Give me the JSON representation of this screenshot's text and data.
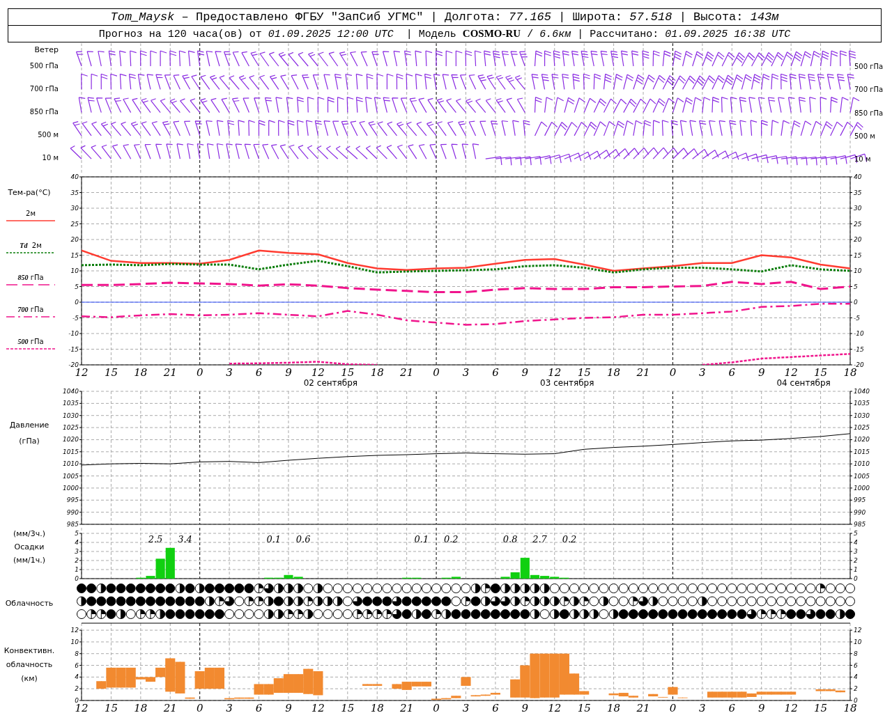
{
  "header": {
    "line_1": "*Tom_Maysk* – Предоставлено ФГБУ \"ЗапСиб УГМС\" | Долгота: *77.165* | Широта: *57.518* | Высота: *143м*",
    "line_2": "Прогноз на 120 часа(ов) от *01.09.2025 12:00 UTC*  | Модель **COSMO-RU** / *6.6км* | Рассчитано: *01.09.2025 16:38 UTC*"
  },
  "wind": {
    "title": "Ветер",
    "levels": [
      {
        "left_label": "500 гПа",
        "right_label": "500 гПа"
      },
      {
        "left_label": "700 гПа",
        "right_label": "700 гПа"
      },
      {
        "left_label": "850 гПа",
        "right_label": "850 гПа"
      },
      {
        "left_label": "500 м",
        "right_label": "500 м"
      },
      {
        "left_label": "10 м",
        "right_label": "10 м"
      }
    ]
  },
  "temperature": {
    "title": "Тем-ра(°C)",
    "right_axis_labels": [
      "40",
      "35",
      "30",
      "25",
      "20",
      "15",
      "10",
      "5",
      "0",
      "-5",
      "-10",
      "-15",
      "-20"
    ],
    "chart_data": {
      "type": "line",
      "categories": [
        "12",
        "15",
        "18",
        "21",
        "0",
        "3",
        "6",
        "9",
        "12",
        "15",
        "18",
        "21",
        "0",
        "3",
        "6",
        "9",
        "12",
        "15",
        "18",
        "21",
        "0",
        "3",
        "6",
        "9",
        "12",
        "15",
        "18"
      ],
      "ylim": [
        -20,
        40
      ],
      "yticks": [
        -20,
        -15,
        -10,
        -5,
        0,
        5,
        10,
        15,
        20,
        25,
        30,
        35,
        40
      ],
      "grid": true,
      "series": [
        {
          "name": "2м",
          "line_style": "solid",
          "color": "#ff3b30",
          "values": [
            16.5,
            13.2,
            12.5,
            12.5,
            12.3,
            13.5,
            16.5,
            15.7,
            15.3,
            12.5,
            10.8,
            10.3,
            10.8,
            11,
            12.3,
            13.5,
            13.8,
            12,
            10,
            10.8,
            11.5,
            12.5,
            12.5,
            15,
            14.3,
            12,
            10.8
          ]
        },
        {
          "name": "*Td*  2м",
          "line_style": "dotted",
          "color": "#0a7d0a",
          "values": [
            11.8,
            12,
            11.8,
            12.2,
            12,
            12,
            10.5,
            12,
            13.2,
            11.5,
            9.5,
            9.8,
            10,
            10.2,
            10.5,
            11.5,
            11.8,
            11,
            9.5,
            10.5,
            11,
            11,
            10.5,
            9.8,
            11.8,
            10.5,
            10
          ]
        },
        {
          "name": "*850* гПа",
          "line_style": "dashed",
          "color": "#f0148c",
          "values": [
            5.5,
            5.5,
            5.8,
            6.2,
            6,
            5.8,
            5.3,
            5.7,
            5.3,
            4.5,
            4,
            3.6,
            3.2,
            3.2,
            4,
            4.5,
            4.2,
            4.2,
            4.8,
            4.8,
            5,
            5.2,
            6.5,
            5.8,
            6.5,
            4.2,
            5
          ]
        },
        {
          "name": "*700* гПа",
          "line_style": "dashdot",
          "color": "#f0148c",
          "values": [
            -4.5,
            -4.8,
            -4.2,
            -3.8,
            -4.2,
            -4,
            -3.5,
            -4,
            -4.5,
            -2.8,
            -4,
            -5.8,
            -6.5,
            -7.2,
            -7,
            -6,
            -5.5,
            -5,
            -4.8,
            -4,
            -4,
            -3.5,
            -3,
            -1.5,
            -1.2,
            -0.5,
            -0.5
          ]
        },
        {
          "name": "*500* гПа",
          "line_style": "densedash",
          "color": "#f0148c",
          "values": [
            null,
            null,
            null,
            null,
            null,
            -19.6,
            -19.5,
            -19.3,
            -19,
            -19.8,
            -20,
            null,
            null,
            null,
            null,
            null,
            null,
            null,
            null,
            null,
            null,
            -20,
            -19.2,
            -18,
            -17.5,
            -17,
            -16.5
          ]
        },
        {
          "line_style": "solid",
          "color": "#3050ff",
          "values": [
            0,
            0,
            0,
            0,
            0,
            0,
            0,
            0,
            0,
            0,
            0,
            0,
            0,
            0,
            0,
            0,
            0,
            0,
            0,
            0,
            0,
            0,
            0,
            0,
            0,
            0,
            0
          ]
        }
      ],
      "annotations": [
        "02 сентября",
        "03 сентября",
        "04 сентября"
      ]
    }
  },
  "pressure": {
    "title": "Давление",
    "unit": "(гПа)",
    "right_axis_labels": [
      "1040",
      "1035",
      "1030",
      "1025",
      "1020",
      "1015",
      "1010",
      "1005",
      "1000",
      "995",
      "990",
      "985"
    ],
    "chart_data": {
      "type": "line",
      "grid": true,
      "ylim": [
        985,
        1040
      ],
      "yticks": [
        985,
        990,
        995,
        1000,
        1005,
        1010,
        1015,
        1020,
        1025,
        1030,
        1035,
        1040
      ],
      "series": [
        {
          "color": "#000000",
          "values": [
            1009.5,
            1010,
            1010.2,
            1010,
            1010.8,
            1011,
            1010.5,
            1011.5,
            1012.3,
            1013,
            1013.5,
            1013.8,
            1014.2,
            1014.5,
            1014.2,
            1014,
            1014.2,
            1016,
            1016.8,
            1017.3,
            1018,
            1018.8,
            1019.5,
            1019.8,
            1020.5,
            1021.3,
            1022.5
          ]
        }
      ]
    }
  },
  "precipitation": {
    "labels": [
      "(мм/3ч.)",
      "Осадки",
      "(мм/1ч.)"
    ],
    "right_axis_labels": [
      "5",
      "4",
      "3",
      "2",
      "1",
      "0"
    ],
    "chart_data": {
      "type": "bar",
      "grid": true,
      "ylim": [
        0,
        5
      ],
      "yticks": [
        0,
        1,
        2,
        3,
        4,
        5
      ],
      "values": [
        null,
        null,
        null,
        null,
        null,
        null,
        0.1,
        0.3,
        2.2,
        3.4,
        null,
        null,
        null,
        null,
        null,
        null,
        null,
        null,
        null,
        0.1,
        0.1,
        0.4,
        0.2,
        null,
        null,
        null,
        null,
        null,
        null,
        null,
        null,
        null,
        null,
        0.1,
        0.1,
        null,
        null,
        0.1,
        0.2,
        null,
        null,
        null,
        null,
        0.2,
        0.7,
        2.3,
        0.4,
        0.3,
        0.2,
        0.1,
        null,
        null,
        null,
        null,
        null,
        null,
        null,
        null,
        null,
        null,
        null,
        null,
        null,
        null,
        null,
        null,
        null,
        null,
        null,
        null,
        null,
        null,
        null,
        null,
        null,
        null,
        null,
        null,
        null
      ],
      "annotations": [
        "2.5",
        "3.4",
        "0.1",
        "0.6",
        "0.1",
        "0.2",
        "0.8",
        "2.7",
        "0.2"
      ]
    }
  },
  "cloudiness": {
    "title": "Облачность",
    "rows": [
      {
        "symbols": [
          {
            "kind": "overcast"
          },
          {
            "kind": "overcast"
          },
          {
            "kind": "half"
          },
          {
            "kind": "overcast"
          },
          {
            "kind": "overcast"
          },
          {
            "kind": "overcast"
          },
          {
            "kind": "overcast"
          },
          {
            "kind": "overcast"
          },
          {
            "kind": "overcast"
          },
          {
            "kind": "overcast"
          },
          {
            "kind": "half"
          },
          {
            "kind": "overcast"
          },
          {
            "kind": "half"
          },
          {
            "kind": "overcast"
          },
          {
            "kind": "overcast"
          },
          {
            "kind": "overcast"
          },
          {
            "kind": "overcast"
          },
          {
            "kind": "overcast"
          },
          {
            "kind": "quarter"
          },
          {
            "kind": "threequarter"
          },
          {
            "kind": "half"
          },
          {
            "kind": "half"
          },
          {
            "kind": "half"
          },
          {
            "kind": "clear"
          },
          {
            "kind": "half"
          },
          {
            "kind": "clear"
          },
          {
            "kind": "clear"
          },
          {
            "kind": "clear"
          },
          {
            "kind": "clear"
          },
          {
            "kind": "clear"
          },
          {
            "kind": "clear"
          },
          {
            "kind": "clear"
          },
          {
            "kind": "clear"
          },
          {
            "kind": "clear"
          },
          {
            "kind": "clear"
          },
          {
            "kind": "clear"
          },
          {
            "kind": "clear"
          },
          {
            "kind": "clear"
          },
          {
            "kind": "clear"
          },
          {
            "kind": "clear"
          },
          {
            "kind": "half"
          },
          {
            "kind": "quarter"
          },
          {
            "kind": "overcast"
          },
          {
            "kind": "half"
          },
          {
            "kind": "half"
          },
          {
            "kind": "half"
          },
          {
            "kind": "half"
          },
          {
            "kind": "half"
          },
          {
            "kind": "clear"
          },
          {
            "kind": "clear"
          },
          {
            "kind": "clear"
          },
          {
            "kind": "clear"
          },
          {
            "kind": "clear"
          },
          {
            "kind": "clear"
          },
          {
            "kind": "clear"
          },
          {
            "kind": "clear"
          },
          {
            "kind": "clear"
          },
          {
            "kind": "clear"
          },
          {
            "kind": "clear"
          },
          {
            "kind": "clear"
          },
          {
            "kind": "clear"
          },
          {
            "kind": "clear"
          },
          {
            "kind": "clear"
          },
          {
            "kind": "clear"
          },
          {
            "kind": "clear"
          },
          {
            "kind": "clear"
          },
          {
            "kind": "clear"
          },
          {
            "kind": "clear"
          },
          {
            "kind": "clear"
          },
          {
            "kind": "clear"
          },
          {
            "kind": "clear"
          },
          {
            "kind": "clear"
          },
          {
            "kind": "clear"
          },
          {
            "kind": "clear"
          },
          {
            "kind": "clear"
          },
          {
            "kind": "quarter"
          },
          {
            "kind": "clear"
          },
          {
            "kind": "clear"
          },
          {
            "kind": "clear"
          }
        ]
      },
      {
        "symbols": [
          {
            "kind": "half"
          },
          {
            "kind": "overcast"
          },
          {
            "kind": "overcast"
          },
          {
            "kind": "overcast"
          },
          {
            "kind": "overcast"
          },
          {
            "kind": "overcast"
          },
          {
            "kind": "overcast"
          },
          {
            "kind": "overcast"
          },
          {
            "kind": "overcast"
          },
          {
            "kind": "overcast"
          },
          {
            "kind": "overcast"
          },
          {
            "kind": "overcast"
          },
          {
            "kind": "overcast"
          },
          {
            "kind": "half"
          },
          {
            "kind": "quarter"
          },
          {
            "kind": "threequarter"
          },
          {
            "kind": "clear"
          },
          {
            "kind": "quarter"
          },
          {
            "kind": "quarter"
          },
          {
            "kind": "half"
          },
          {
            "kind": "overcast"
          },
          {
            "kind": "half"
          },
          {
            "kind": "half"
          },
          {
            "kind": "quarter"
          },
          {
            "kind": "half"
          },
          {
            "kind": "half"
          },
          {
            "kind": "half"
          },
          {
            "kind": "clear"
          },
          {
            "kind": "threequarter"
          },
          {
            "kind": "overcast"
          },
          {
            "kind": "overcast"
          },
          {
            "kind": "overcast"
          },
          {
            "kind": "threequarter"
          },
          {
            "kind": "overcast"
          },
          {
            "kind": "overcast"
          },
          {
            "kind": "overcast"
          },
          {
            "kind": "overcast"
          },
          {
            "kind": "overcast"
          },
          {
            "kind": "clear"
          },
          {
            "kind": "quarter"
          },
          {
            "kind": "overcast"
          },
          {
            "kind": "half"
          },
          {
            "kind": "threequarter"
          },
          {
            "kind": "threequarter"
          },
          {
            "kind": "half"
          },
          {
            "kind": "quarter"
          },
          {
            "kind": "half"
          },
          {
            "kind": "half"
          },
          {
            "kind": "half"
          },
          {
            "kind": "quarter"
          },
          {
            "kind": "half"
          },
          {
            "kind": "quarter"
          },
          {
            "kind": "clear"
          },
          {
            "kind": "half"
          },
          {
            "kind": "clear"
          },
          {
            "kind": "clear"
          },
          {
            "kind": "quarter"
          },
          {
            "kind": "threequarter"
          },
          {
            "kind": "half"
          },
          {
            "kind": "clear"
          },
          {
            "kind": "clear"
          },
          {
            "kind": "clear"
          },
          {
            "kind": "clear"
          },
          {
            "kind": "half"
          },
          {
            "kind": "clear"
          },
          {
            "kind": "clear"
          },
          {
            "kind": "clear"
          },
          {
            "kind": "clear"
          },
          {
            "kind": "clear"
          },
          {
            "kind": "clear"
          },
          {
            "kind": "clear"
          },
          {
            "kind": "clear"
          },
          {
            "kind": "clear"
          },
          {
            "kind": "clear"
          },
          {
            "kind": "clear"
          },
          {
            "kind": "clear"
          },
          {
            "kind": "clear"
          },
          {
            "kind": "clear"
          },
          {
            "kind": "clear"
          }
        ]
      },
      {
        "symbols": [
          {
            "kind": "clear"
          },
          {
            "kind": "quarter"
          },
          {
            "kind": "quarter"
          },
          {
            "kind": "overcast"
          },
          {
            "kind": "half"
          },
          {
            "kind": "clear"
          },
          {
            "kind": "quarter"
          },
          {
            "kind": "quarter"
          },
          {
            "kind": "half"
          },
          {
            "kind": "overcast"
          },
          {
            "kind": "overcast"
          },
          {
            "kind": "overcast"
          },
          {
            "kind": "overcast"
          },
          {
            "kind": "overcast"
          },
          {
            "kind": "overcast"
          },
          {
            "kind": "clear"
          },
          {
            "kind": "clear"
          },
          {
            "kind": "clear"
          },
          {
            "kind": "clear"
          },
          {
            "kind": "half"
          },
          {
            "kind": "half"
          },
          {
            "kind": "quarter"
          },
          {
            "kind": "quarter"
          },
          {
            "kind": "half"
          },
          {
            "kind": "clear"
          },
          {
            "kind": "clear"
          },
          {
            "kind": "clear"
          },
          {
            "kind": "clear"
          },
          {
            "kind": "quarter"
          },
          {
            "kind": "quarter"
          },
          {
            "kind": "quarter"
          },
          {
            "kind": "quarter"
          },
          {
            "kind": "threequarter"
          },
          {
            "kind": "overcast"
          },
          {
            "kind": "half"
          },
          {
            "kind": "overcast"
          },
          {
            "kind": "quarter"
          },
          {
            "kind": "half"
          },
          {
            "kind": "overcast"
          },
          {
            "kind": "overcast"
          },
          {
            "kind": "overcast"
          },
          {
            "kind": "overcast"
          },
          {
            "kind": "overcast"
          },
          {
            "kind": "overcast"
          },
          {
            "kind": "overcast"
          },
          {
            "kind": "overcast"
          },
          {
            "kind": "half"
          },
          {
            "kind": "clear"
          },
          {
            "kind": "half"
          },
          {
            "kind": "overcast"
          },
          {
            "kind": "half"
          },
          {
            "kind": "half"
          },
          {
            "kind": "half"
          },
          {
            "kind": "clear"
          },
          {
            "kind": "half"
          },
          {
            "kind": "overcast"
          },
          {
            "kind": "overcast"
          },
          {
            "kind": "overcast"
          },
          {
            "kind": "overcast"
          },
          {
            "kind": "overcast"
          },
          {
            "kind": "overcast"
          },
          {
            "kind": "overcast"
          },
          {
            "kind": "overcast"
          },
          {
            "kind": "overcast"
          },
          {
            "kind": "overcast"
          },
          {
            "kind": "overcast"
          },
          {
            "kind": "overcast"
          },
          {
            "kind": "overcast"
          },
          {
            "kind": "threequarter"
          },
          {
            "kind": "quarter"
          },
          {
            "kind": "quarter"
          },
          {
            "kind": "quarter"
          },
          {
            "kind": "overcast"
          },
          {
            "kind": "overcast"
          },
          {
            "kind": "threequarter"
          },
          {
            "kind": "overcast"
          },
          {
            "kind": "overcast"
          },
          {
            "kind": "half"
          },
          {
            "kind": "overcast"
          }
        ]
      }
    ]
  },
  "convective": {
    "labels": [
      "Конвективн.",
      "облачность",
      "(км)"
    ],
    "right_axis_labels": [
      "12",
      "10",
      "8",
      "6",
      "4",
      "2",
      "0"
    ],
    "chart_data": {
      "type": "candlestick",
      "grid": true,
      "ylim": [
        0,
        13.2
      ],
      "yticks": [
        0,
        2,
        4,
        6,
        8,
        10,
        12
      ],
      "categories": [
        "12",
        null,
        null,
        "15",
        null,
        null,
        "18",
        null,
        null,
        "21",
        null,
        null,
        "0",
        null,
        null,
        "3",
        null,
        null,
        "6",
        null,
        null,
        "9",
        null,
        null,
        "12",
        null,
        null,
        "15",
        null,
        null,
        "18",
        null,
        null,
        "21",
        null,
        null,
        "0",
        null,
        null,
        "3",
        null,
        null,
        "6",
        null,
        null,
        "9",
        null,
        null,
        "12",
        null,
        null,
        "15",
        null,
        null,
        "18",
        null,
        null,
        "21",
        null,
        null,
        "0",
        null,
        null,
        "3",
        null,
        null,
        "6",
        null,
        null,
        "9",
        null,
        null,
        "12",
        null,
        null,
        "15",
        null,
        null,
        "18"
      ],
      "color": "#f28a30",
      "ohlc": [
        null,
        null,
        [
          2,
          3.3,
          2,
          3.3
        ],
        [
          2.2,
          5.6,
          2.2,
          5.6
        ],
        [
          2.2,
          5.6,
          2.2,
          5.6
        ],
        [
          2.2,
          5.6,
          2.2,
          5.6
        ],
        [
          3.6,
          4,
          3.6,
          4
        ],
        [
          3.2,
          4,
          3.2,
          4
        ],
        [
          4,
          5.6,
          4,
          5.6
        ],
        [
          1.5,
          7.2,
          1.5,
          7.2
        ],
        [
          1.2,
          6.6,
          1.2,
          6.6
        ],
        [
          0.3,
          0.5,
          0.3,
          0.5
        ],
        [
          2,
          5,
          2,
          5
        ],
        [
          2,
          5.6,
          2,
          5.6
        ],
        [
          2,
          5.6,
          2,
          5.6
        ],
        [
          0.2,
          0.4,
          0.2,
          0.4
        ],
        [
          0.3,
          0.5,
          0.3,
          0.5
        ],
        [
          0.3,
          0.5,
          0.3,
          0.5
        ],
        [
          1,
          2.8,
          1,
          2.8
        ],
        [
          1,
          2.8,
          1,
          2.8
        ],
        [
          1.3,
          3.8,
          1.3,
          3.8
        ],
        [
          1.3,
          4.5,
          1.3,
          4.5
        ],
        [
          1.3,
          4.5,
          1.3,
          4.5
        ],
        [
          1.1,
          5.4,
          1.1,
          5.4
        ],
        [
          0.9,
          5,
          0.9,
          5
        ],
        null,
        null,
        null,
        null,
        [
          2.5,
          2.8,
          2.5,
          2.8
        ],
        [
          2.5,
          2.8,
          2.5,
          2.8
        ],
        null,
        [
          2,
          2.8,
          2,
          2.8
        ],
        [
          1.8,
          3.2,
          1.8,
          3.2
        ],
        [
          2.4,
          3.2,
          2.4,
          3.2
        ],
        [
          2.4,
          3.2,
          2.4,
          3.2
        ],
        [
          0.1,
          0.3,
          0.1,
          0.3
        ],
        [
          0.2,
          0.4,
          0.2,
          0.4
        ],
        [
          0.4,
          0.8,
          0.4,
          0.8
        ],
        [
          2.5,
          4,
          2.5,
          4
        ],
        [
          0.7,
          0.9,
          0.7,
          0.9
        ],
        [
          0.8,
          1,
          0.8,
          1
        ],
        [
          1,
          1.3,
          1,
          1.3
        ],
        null,
        [
          0.5,
          3.6,
          0.5,
          3.6
        ],
        [
          0.5,
          6,
          0.5,
          6
        ],
        [
          0.4,
          8,
          0.4,
          8
        ],
        [
          0.5,
          8,
          0.5,
          8
        ],
        [
          0.5,
          8,
          0.5,
          8
        ],
        [
          1,
          8,
          1,
          8
        ],
        [
          1,
          4.6,
          1,
          4.6
        ],
        [
          1,
          1.6,
          1,
          1.6
        ],
        null,
        null,
        [
          0.9,
          1.2,
          0.9,
          1.2
        ],
        [
          0.7,
          1.3,
          0.7,
          1.3
        ],
        [
          0.5,
          0.8,
          0.5,
          0.8
        ],
        null,
        [
          0.7,
          1.1,
          0.7,
          1.1
        ],
        [
          0.5,
          0.6,
          0.5,
          0.6
        ],
        [
          1,
          2.3,
          1,
          2.3
        ],
        [
          0.4,
          0.5,
          0.4,
          0.5
        ],
        null,
        null,
        [
          0.5,
          1.5,
          0.5,
          1.5
        ],
        [
          0.5,
          1.5,
          0.5,
          1.5
        ],
        [
          0.5,
          1.5,
          0.5,
          1.5
        ],
        [
          0.5,
          1.5,
          0.5,
          1.5
        ],
        [
          0.6,
          1.2,
          0.6,
          1.2
        ],
        [
          1,
          1.5,
          1,
          1.5
        ],
        [
          1,
          1.5,
          1,
          1.5
        ],
        [
          1,
          1.5,
          1,
          1.5
        ],
        [
          1,
          1.5,
          1,
          1.5
        ],
        null,
        null,
        [
          1.6,
          1.9,
          1.6,
          1.9
        ],
        [
          1.6,
          1.9,
          1.6,
          1.9
        ],
        [
          1.4,
          1.7,
          1.4,
          1.7
        ],
        null
      ]
    }
  }
}
